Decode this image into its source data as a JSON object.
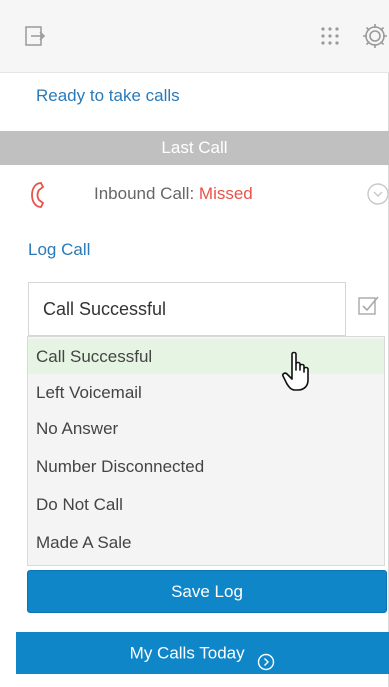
{
  "toolbar": {
    "icons": [
      "logout-icon",
      "app-grid-icon",
      "gear-icon"
    ]
  },
  "status": {
    "text": "Ready to take calls",
    "color": "#2a7ab9"
  },
  "last_call": {
    "header": "Last Call",
    "direction_label": "Inbound Call: ",
    "status": "Missed",
    "status_color": "#e8534a"
  },
  "log_call": {
    "link_label": "Log Call",
    "selected_value": "Call Successful",
    "options": [
      "Call Successful",
      "Left Voicemail",
      "No Answer",
      "Number Disconnected",
      "Do Not Call",
      "Made A Sale"
    ],
    "save_label": "Save Log"
  },
  "footer": {
    "my_calls_label": "My Calls Today"
  },
  "colors": {
    "accent_blue": "#0e86c8",
    "link_blue": "#2a7ab9",
    "missed_red": "#e8534a",
    "header_gray": "#c0c0c0"
  }
}
